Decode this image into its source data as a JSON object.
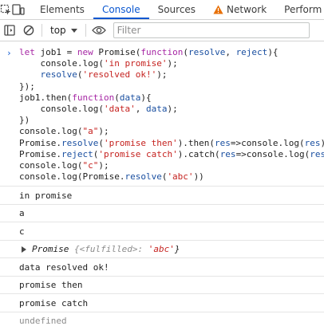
{
  "tabs": [
    {
      "label": "Elements"
    },
    {
      "label": "Console"
    },
    {
      "label": "Sources"
    },
    {
      "label": "Network"
    },
    {
      "label": "Perform"
    }
  ],
  "toolbar": {
    "context": "top",
    "filter_placeholder": "Filter"
  },
  "input_lines": [
    "let job1 = new Promise(function(resolve, reject){",
    "    console.log('in promise');",
    "    resolve('resolved ok!');",
    "});",
    "job1.then(function(data){",
    "    console.log('data', data);",
    "})",
    "console.log(\"a\");",
    "Promise.resolve('promise then').then(res=>console.log(res));",
    "Promise.reject('promise catch').catch(res=>console.log(res));",
    "console.log(\"c\");",
    "console.log(Promise.resolve('abc'))"
  ],
  "outputs": [
    "in promise",
    "a",
    "c"
  ],
  "promise_output": {
    "name": "Promise",
    "state": "{<fulfilled>:",
    "value": "'abc'",
    "close": "}"
  },
  "outputs_after": [
    "data resolved ok!",
    "promise then",
    "promise catch"
  ],
  "return_value": "undefined",
  "colors": {
    "accent": "#0b57d0",
    "string": "#c5221f",
    "keyword": "#a626a4",
    "warning": "#e8710a"
  }
}
